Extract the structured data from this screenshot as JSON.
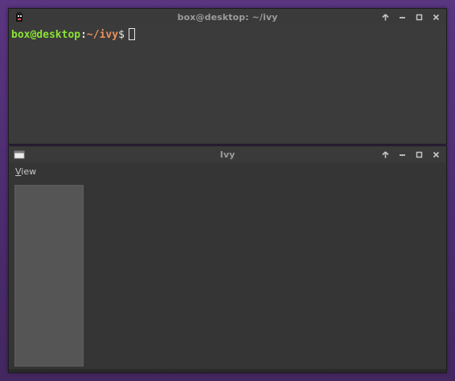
{
  "terminal": {
    "title": "box@desktop: ~/ivy",
    "prompt_user": "box@desktop",
    "prompt_colon": ":",
    "prompt_path": "~/ivy",
    "prompt_symbol": "$"
  },
  "ivy": {
    "title": "Ivy",
    "menu": {
      "view_first": "V",
      "view_rest": "iew"
    }
  },
  "colors": {
    "desktop": "#4a2d6b",
    "prompt_user": "#8ae234",
    "prompt_path": "#e9915c"
  },
  "icons": {
    "terminal_app": "terminal-app-icon",
    "ivy_app": "window-app-icon",
    "shade": "arrow-up-icon",
    "minimize": "minimize-icon",
    "maximize": "maximize-icon",
    "close": "close-icon"
  }
}
